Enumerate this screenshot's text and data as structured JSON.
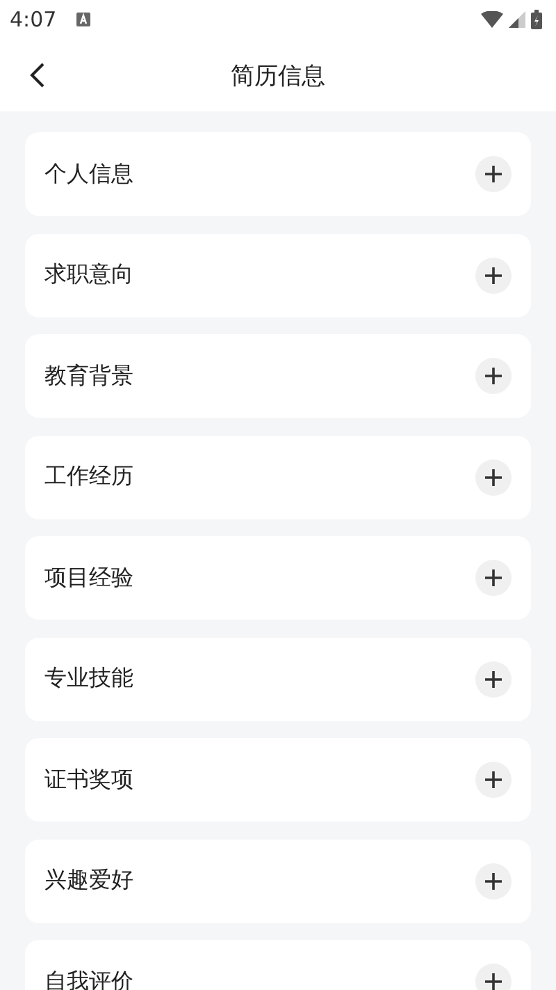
{
  "status_bar": {
    "time": "4:07"
  },
  "header": {
    "title": "简历信息"
  },
  "sections": [
    {
      "label": "个人信息"
    },
    {
      "label": "求职意向"
    },
    {
      "label": "教育背景"
    },
    {
      "label": "工作经历"
    },
    {
      "label": "项目经验"
    },
    {
      "label": "专业技能"
    },
    {
      "label": "证书奖项"
    },
    {
      "label": "兴趣爱好"
    },
    {
      "label": "自我评价"
    }
  ]
}
